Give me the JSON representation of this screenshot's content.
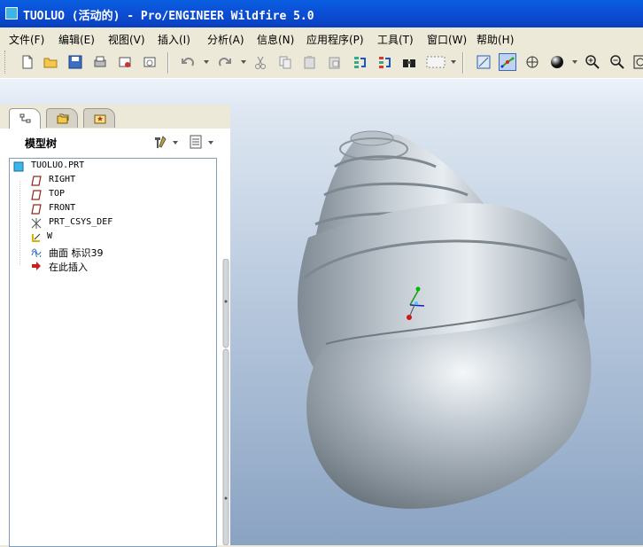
{
  "window": {
    "title": "TUOLUO (活动的) - Pro/ENGINEER Wildfire 5.0"
  },
  "menu": [
    {
      "label": "文件(F)"
    },
    {
      "label": "编辑(E)"
    },
    {
      "label": "视图(V)"
    },
    {
      "label": "插入(I)"
    },
    {
      "label": "分析(A)"
    },
    {
      "label": "信息(N)"
    },
    {
      "label": "应用程序(P)"
    },
    {
      "label": "工具(T)"
    },
    {
      "label": "窗口(W)"
    },
    {
      "label": "帮助(H)"
    }
  ],
  "panel": {
    "title": "模型树"
  },
  "tree": {
    "root": "TUOLUO.PRT",
    "items": [
      {
        "label": "RIGHT",
        "icon": "datum-plane-icon"
      },
      {
        "label": "TOP",
        "icon": "datum-plane-icon"
      },
      {
        "label": "FRONT",
        "icon": "datum-plane-icon"
      },
      {
        "label": "PRT_CSYS_DEF",
        "icon": "csys-icon"
      },
      {
        "label": "W",
        "icon": "axis-icon"
      },
      {
        "label": "曲面 标识39",
        "icon": "surface-icon"
      },
      {
        "label": "在此插入",
        "icon": "insert-here-arrow-icon"
      }
    ]
  },
  "colors": {
    "titlebar": "#0b4fd6",
    "viewport_top": "#dfe8f2",
    "viewport_bottom": "#8aa3c2",
    "shell": "#a9b3bc"
  }
}
